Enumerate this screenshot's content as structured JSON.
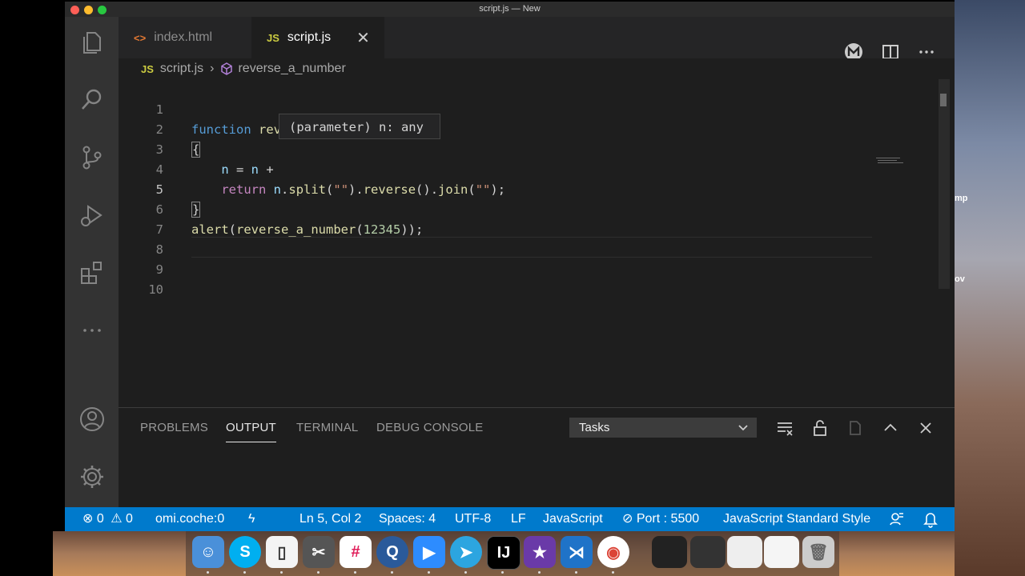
{
  "window": {
    "title": "script.js — New"
  },
  "tabs": [
    {
      "icon": "<>",
      "label": "index.html"
    },
    {
      "icon": "JS",
      "label": "script.js",
      "close": "✕"
    }
  ],
  "breadcrumb": {
    "file_icon": "JS",
    "file": "script.js",
    "symbol": "reverse_a_number"
  },
  "editor": {
    "line_numbers": [
      "1",
      "2",
      "3",
      "4",
      "5",
      "6",
      "7",
      "8",
      "9",
      "10"
    ],
    "hover": "(parameter) n: any"
  },
  "panel": {
    "tabs": [
      "PROBLEMS",
      "OUTPUT",
      "TERMINAL",
      "DEBUG CONSOLE"
    ],
    "active_tab": "OUTPUT",
    "task_select": "Tasks"
  },
  "statusbar": {
    "errors": "0",
    "warnings": "0",
    "branch": "omi.coche:0",
    "position": "Ln 5, Col 2",
    "spaces": "Spaces: 4",
    "encoding": "UTF-8",
    "eol": "LF",
    "language": "JavaScript",
    "port": "Port : 5500",
    "linter": "JavaScript Standard Style"
  },
  "desktop": {
    "frag1": "mp",
    "frag2": "ov"
  },
  "colors": {
    "statusbar": "#007acc",
    "editor_bg": "#1e1e1e",
    "activitybar": "#333333",
    "sidebar_tabbar": "#252526"
  }
}
